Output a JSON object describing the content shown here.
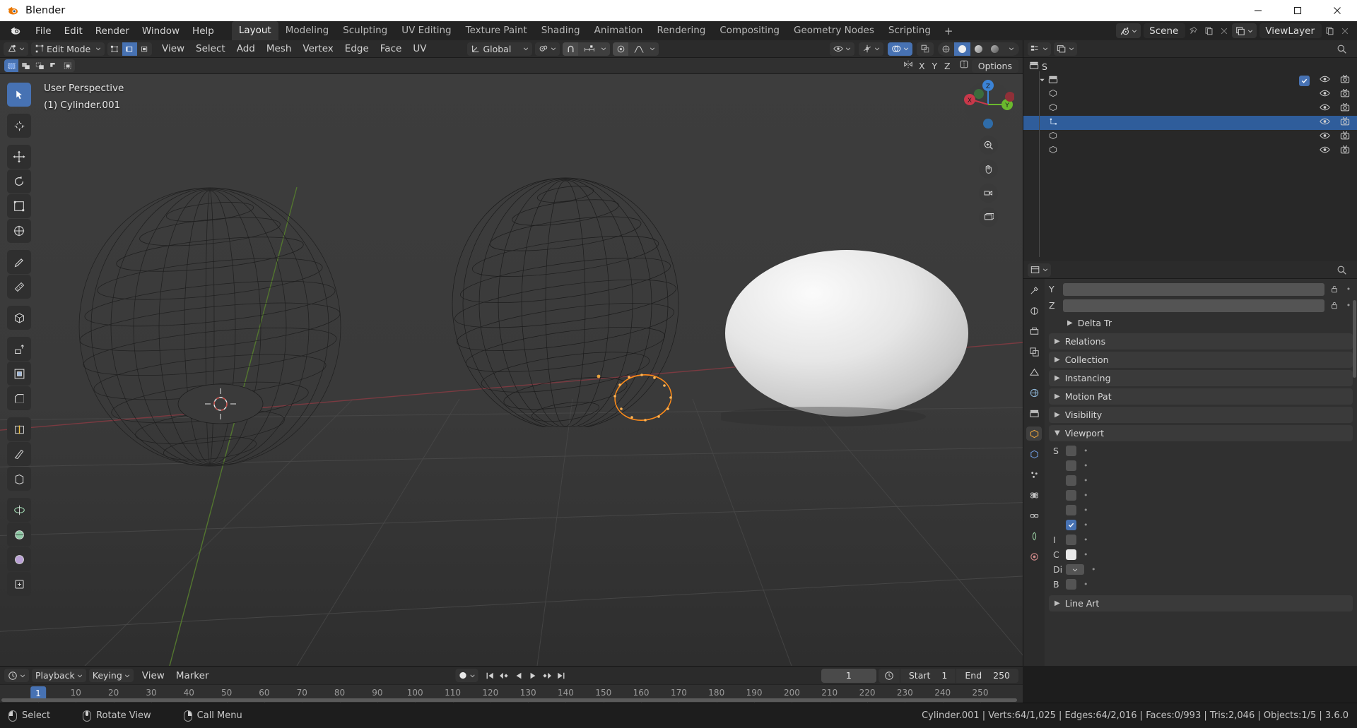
{
  "window": {
    "title": "Blender",
    "controls": [
      "minimize",
      "maximize",
      "close"
    ]
  },
  "topbar": {
    "menus": [
      "File",
      "Edit",
      "Render",
      "Window",
      "Help"
    ],
    "workspaces": [
      {
        "label": "Layout",
        "active": true
      },
      {
        "label": "Modeling",
        "active": false
      },
      {
        "label": "Sculpting",
        "active": false
      },
      {
        "label": "UV Editing",
        "active": false
      },
      {
        "label": "Texture Paint",
        "active": false
      },
      {
        "label": "Shading",
        "active": false
      },
      {
        "label": "Animation",
        "active": false
      },
      {
        "label": "Rendering",
        "active": false
      },
      {
        "label": "Compositing",
        "active": false
      },
      {
        "label": "Geometry Nodes",
        "active": false
      },
      {
        "label": "Scripting",
        "active": false
      }
    ],
    "add_workspace": "+",
    "scene_name": "Scene",
    "view_layer_name": "ViewLayer"
  },
  "viewport_header": {
    "mode": "Edit Mode",
    "menus": [
      "View",
      "Select",
      "Add",
      "Mesh",
      "Vertex",
      "Edge",
      "Face",
      "UV"
    ],
    "transform_orientation": "Global",
    "select_mode_icons": [
      "vertex-select",
      "edge-select",
      "face-select"
    ],
    "snap_icon": "magnet-icon",
    "proportional_icon": "proportional-edit-icon",
    "shading_modes": [
      "wireframe",
      "solid",
      "material-preview",
      "rendered"
    ],
    "active_shading": "solid"
  },
  "viewport_subheader": {
    "axis_buttons": [
      "X",
      "Y",
      "Z"
    ],
    "options_label": "Options"
  },
  "viewport": {
    "overlay_line1": "User Perspective",
    "overlay_line2": "(1) Cylinder.001",
    "gizmo_axes": [
      "X",
      "Y",
      "Z"
    ],
    "tools": [
      "tweak-select-box-icon",
      "cursor-icon",
      "move-icon",
      "rotate-icon",
      "scale-icon",
      "transform-icon",
      "annotate-icon",
      "measure-icon",
      "add-cube-icon",
      "extrude-region-icon",
      "inset-faces-icon",
      "bevel-icon",
      "loop-cut-icon",
      "knife-icon",
      "poly-build-icon",
      "spin-icon",
      "smooth-icon",
      "edge-slide-icon",
      "shrink-fatten-icon",
      "shear-icon",
      "rip-region-icon"
    ],
    "gizmo_buttons": [
      "zoom-icon",
      "pan-hand-icon",
      "camera-view-icon",
      "toggle-ortho-icon"
    ]
  },
  "timeline": {
    "menus": [
      "Playback",
      "Keying",
      "View",
      "Marker"
    ],
    "current_frame": "1",
    "start_label": "Start",
    "start_value": "1",
    "end_label": "End",
    "end_value": "250",
    "ticks": [
      "1",
      "10",
      "20",
      "30",
      "40",
      "50",
      "60",
      "70",
      "80",
      "90",
      "100",
      "110",
      "120",
      "130",
      "140",
      "150",
      "160",
      "170",
      "180",
      "190",
      "200",
      "210",
      "220",
      "230",
      "240",
      "250"
    ],
    "playhead_label": "1"
  },
  "outliner": {
    "rows": [
      {
        "label": "S",
        "indent": 0,
        "type": "scene-collection",
        "selected": false,
        "has_expand": false,
        "has_check": false,
        "has_eye": false,
        "has_cam": false
      },
      {
        "label": "",
        "indent": 1,
        "type": "collection",
        "selected": false,
        "has_expand": true,
        "has_check": true,
        "has_eye": true,
        "has_cam": true
      },
      {
        "label": "",
        "indent": 2,
        "type": "object",
        "selected": false,
        "has_expand": false,
        "has_check": false,
        "has_eye": true,
        "has_cam": true
      },
      {
        "label": "",
        "indent": 2,
        "type": "object",
        "selected": false,
        "has_expand": false,
        "has_check": false,
        "has_eye": true,
        "has_cam": true
      },
      {
        "label": "",
        "indent": 2,
        "type": "mesh-object",
        "selected": true,
        "has_expand": false,
        "has_check": false,
        "has_eye": true,
        "has_cam": true
      },
      {
        "label": "",
        "indent": 2,
        "type": "object",
        "selected": false,
        "has_expand": false,
        "has_check": false,
        "has_eye": true,
        "has_cam": true
      },
      {
        "label": "",
        "indent": 2,
        "type": "object",
        "selected": false,
        "has_expand": false,
        "has_check": false,
        "has_eye": true,
        "has_cam": true
      }
    ]
  },
  "properties": {
    "axis_rows": [
      {
        "label": "Y"
      },
      {
        "label": "Z"
      }
    ],
    "panels": [
      {
        "label": "Delta Tr",
        "open": false,
        "sub": true
      },
      {
        "label": "Relations",
        "open": false,
        "sub": false
      },
      {
        "label": "Collection",
        "open": false,
        "sub": false
      },
      {
        "label": "Instancing",
        "open": false,
        "sub": false
      },
      {
        "label": "Motion Pat",
        "open": false,
        "sub": false
      },
      {
        "label": "Visibility",
        "open": false,
        "sub": false
      },
      {
        "label": "Viewport",
        "open": true,
        "sub": false
      }
    ],
    "viewport_fields": [
      {
        "label": "S",
        "kind": "field"
      },
      {
        "label": "",
        "kind": "field"
      },
      {
        "label": "",
        "kind": "field"
      },
      {
        "label": "",
        "kind": "field"
      },
      {
        "label": "",
        "kind": "field"
      },
      {
        "label": "",
        "kind": "checked"
      },
      {
        "label": "I",
        "kind": "field"
      },
      {
        "label": "C",
        "kind": "white"
      },
      {
        "label": "Di",
        "kind": "dropdown"
      },
      {
        "label": "B",
        "kind": "field"
      }
    ],
    "line_art_label": "Line Art",
    "tabs": [
      "tool-icon",
      "render-icon",
      "output-icon",
      "view-layer-icon",
      "scene-icon",
      "world-icon",
      "collection-icon",
      "object-icon",
      "modifiers-icon",
      "particles-icon",
      "physics-icon",
      "constraints-icon",
      "data-icon",
      "material-icon"
    ]
  },
  "statusbar": {
    "hints": [
      {
        "icon": "mouse-left",
        "label": "Select"
      },
      {
        "icon": "mouse-middle",
        "label": "Rotate View"
      },
      {
        "icon": "mouse-right",
        "label": "Call Menu"
      }
    ],
    "stats": "Cylinder.001 | Verts:64/1,025 | Edges:64/2,016 | Faces:0/993 | Tris:2,046 | Objects:1/5 | 3.6.0"
  },
  "colors": {
    "accent_blue": "#4772b3",
    "selected_orange": "#ff8c19",
    "axis_x_red": "#c9384a",
    "axis_y_green": "#6ab82e",
    "axis_z_blue": "#3b83d6",
    "panel_bg": "#303030",
    "header_bg": "#2b2b2b"
  }
}
